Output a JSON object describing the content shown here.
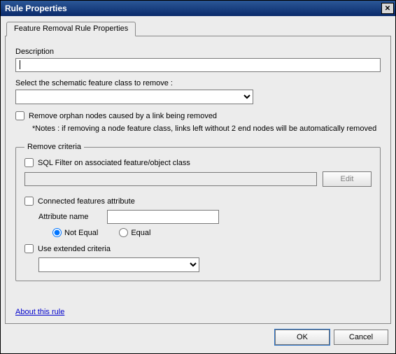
{
  "window": {
    "title": "Rule Properties"
  },
  "tab": {
    "label": "Feature Removal Rule Properties"
  },
  "description": {
    "label": "Description",
    "value": ""
  },
  "featureClass": {
    "label": "Select the schematic feature class to remove :",
    "value": ""
  },
  "orphan": {
    "label": "Remove orphan nodes caused by a link being removed",
    "checked": false
  },
  "note": "*Notes : if removing a node feature class, links left without 2 end nodes will be automatically removed",
  "criteria": {
    "legend": "Remove criteria",
    "sqlFilter": {
      "label": "SQL Filter on associated feature/object class",
      "checked": false,
      "value": ""
    },
    "editBtn": "Edit",
    "connected": {
      "label": "Connected features attribute",
      "checked": false,
      "attrLabel": "Attribute name",
      "attrValue": "",
      "radio": "notEqual",
      "notEqualLabel": "Not Equal",
      "equalLabel": "Equal"
    },
    "extended": {
      "label": "Use extended criteria",
      "checked": false,
      "value": ""
    }
  },
  "link": "About this rule",
  "buttons": {
    "ok": "OK",
    "cancel": "Cancel"
  }
}
